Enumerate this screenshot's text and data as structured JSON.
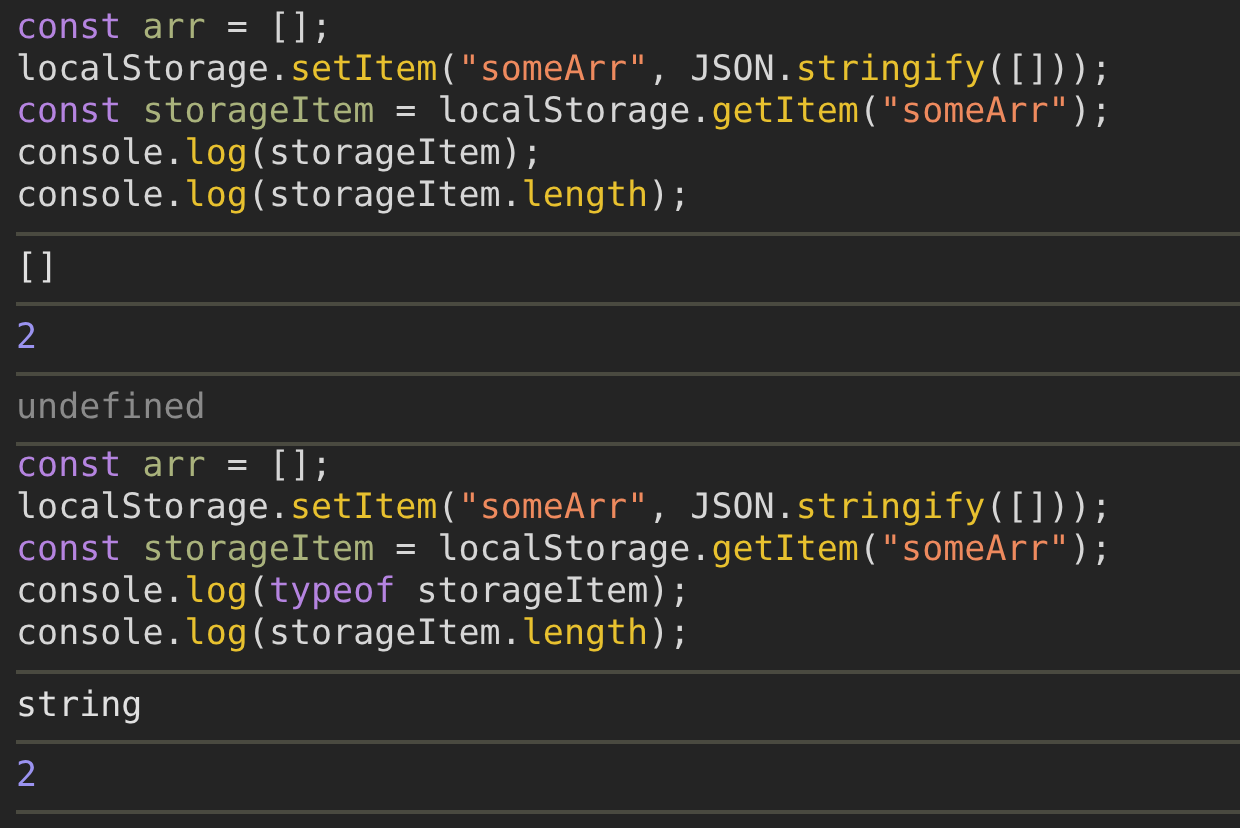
{
  "entries": [
    {
      "kind": "input",
      "lines": [
        [
          {
            "kind": "keyword",
            "text": "const"
          },
          {
            "kind": "variable",
            "text": "arr"
          },
          {
            "kind": "plain",
            "text": " = [];"
          }
        ],
        [
          {
            "kind": "plain",
            "text": "localStorage."
          },
          {
            "kind": "method",
            "text": "setItem"
          },
          {
            "kind": "plain",
            "text": "("
          },
          {
            "kind": "string",
            "text": "\"someArr\""
          },
          {
            "kind": "plain",
            "text": ", JSON."
          },
          {
            "kind": "method",
            "text": "stringify"
          },
          {
            "kind": "plain",
            "text": "([]));"
          }
        ],
        [
          {
            "kind": "keyword",
            "text": "const"
          },
          {
            "kind": "variable",
            "text": "storageItem"
          },
          {
            "kind": "plain",
            "text": " = localStorage."
          },
          {
            "kind": "method",
            "text": "getItem"
          },
          {
            "kind": "plain",
            "text": "("
          },
          {
            "kind": "string",
            "text": "\"someArr\""
          },
          {
            "kind": "plain",
            "text": ");"
          }
        ],
        [
          {
            "kind": "plain",
            "text": "console."
          },
          {
            "kind": "method",
            "text": "log"
          },
          {
            "kind": "plain",
            "text": "(storageItem);"
          }
        ],
        [
          {
            "kind": "plain",
            "text": "console."
          },
          {
            "kind": "method",
            "text": "log"
          },
          {
            "kind": "plain",
            "text": "(storageItem."
          },
          {
            "kind": "method",
            "text": "length"
          },
          {
            "kind": "plain",
            "text": ");"
          }
        ]
      ]
    },
    {
      "kind": "text",
      "text": "[]"
    },
    {
      "kind": "number",
      "text": "2"
    },
    {
      "kind": "undefined",
      "text": "undefined"
    },
    {
      "kind": "input",
      "lines": [
        [
          {
            "kind": "keyword",
            "text": "const"
          },
          {
            "kind": "variable",
            "text": "arr"
          },
          {
            "kind": "plain",
            "text": " = [];"
          }
        ],
        [
          {
            "kind": "plain",
            "text": "localStorage."
          },
          {
            "kind": "method",
            "text": "setItem"
          },
          {
            "kind": "plain",
            "text": "("
          },
          {
            "kind": "string",
            "text": "\"someArr\""
          },
          {
            "kind": "plain",
            "text": ", JSON."
          },
          {
            "kind": "method",
            "text": "stringify"
          },
          {
            "kind": "plain",
            "text": "([]));"
          }
        ],
        [
          {
            "kind": "keyword",
            "text": "const"
          },
          {
            "kind": "variable",
            "text": "storageItem"
          },
          {
            "kind": "plain",
            "text": " = localStorage."
          },
          {
            "kind": "method",
            "text": "getItem"
          },
          {
            "kind": "plain",
            "text": "("
          },
          {
            "kind": "string",
            "text": "\"someArr\""
          },
          {
            "kind": "plain",
            "text": ");"
          }
        ],
        [
          {
            "kind": "plain",
            "text": "console."
          },
          {
            "kind": "method",
            "text": "log"
          },
          {
            "kind": "plain",
            "text": "("
          },
          {
            "kind": "keyword",
            "text": "typeof"
          },
          {
            "kind": "plain",
            "text": " storageItem);"
          }
        ],
        [
          {
            "kind": "plain",
            "text": "console."
          },
          {
            "kind": "method",
            "text": "log"
          },
          {
            "kind": "plain",
            "text": "(storageItem."
          },
          {
            "kind": "method",
            "text": "length"
          },
          {
            "kind": "plain",
            "text": ");"
          }
        ]
      ]
    },
    {
      "kind": "text",
      "text": "string"
    },
    {
      "kind": "number",
      "text": "2"
    }
  ]
}
